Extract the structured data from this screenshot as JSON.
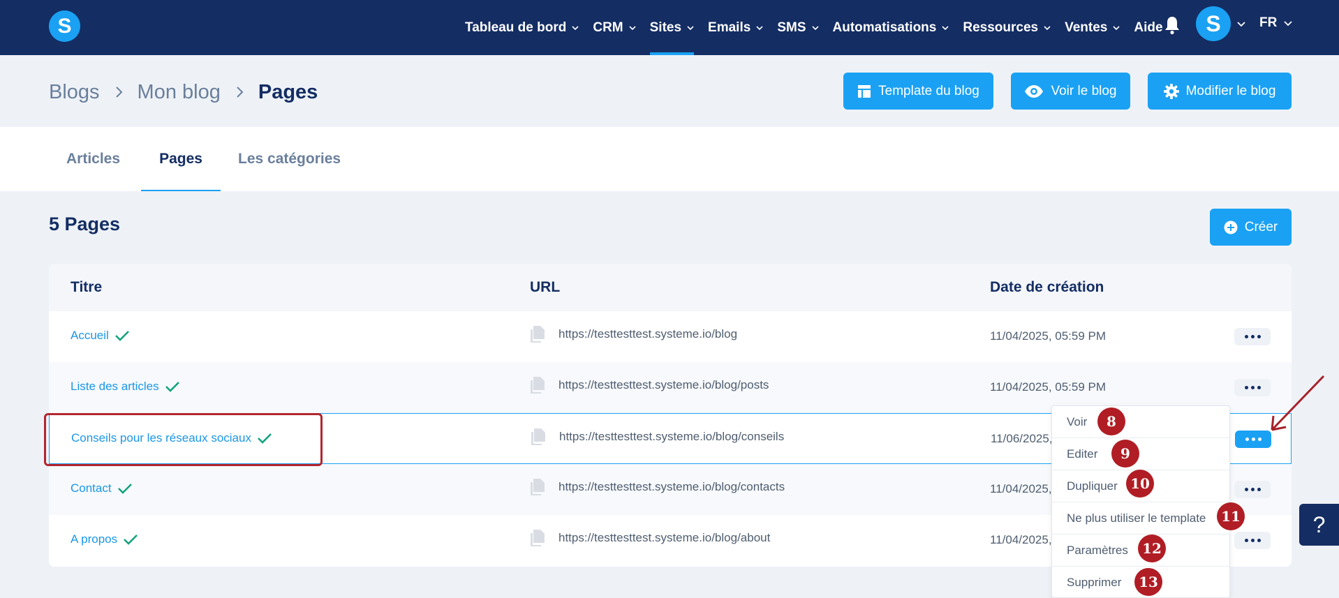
{
  "nav": {
    "logo": "S",
    "items": [
      {
        "label": "Tableau de bord",
        "chevron": true
      },
      {
        "label": "CRM",
        "chevron": true
      },
      {
        "label": "Sites",
        "chevron": true,
        "active": true
      },
      {
        "label": "Emails",
        "chevron": true
      },
      {
        "label": "SMS",
        "chevron": true
      },
      {
        "label": "Automatisations",
        "chevron": true
      },
      {
        "label": "Ressources",
        "chevron": true
      },
      {
        "label": "Ventes",
        "chevron": true
      },
      {
        "label": "Aide",
        "chevron": false
      }
    ],
    "avatar": "S",
    "language": "FR"
  },
  "breadcrumb": [
    "Blogs",
    "Mon blog",
    "Pages"
  ],
  "header_buttons": {
    "template": "Template du blog",
    "view": "Voir le blog",
    "edit": "Modifier le blog"
  },
  "tabs": [
    {
      "label": "Articles",
      "active": false
    },
    {
      "label": "Pages",
      "active": true
    },
    {
      "label": "Les catégories",
      "active": false
    }
  ],
  "page_count_title": "5 Pages",
  "create_label": "Créer",
  "table": {
    "headers": {
      "title": "Titre",
      "url": "URL",
      "date": "Date de création"
    },
    "rows": [
      {
        "title": "Accueil",
        "url": "https://testtesttest.systeme.io/blog",
        "date": "11/04/2025, 05:59 PM"
      },
      {
        "title": "Liste des articles",
        "url": "https://testtesttest.systeme.io/blog/posts",
        "date": "11/04/2025, 05:59 PM"
      },
      {
        "title": "Conseils pour les réseaux sociaux",
        "url": "https://testtesttest.systeme.io/blog/conseils",
        "date": "11/06/2025,"
      },
      {
        "title": "Contact",
        "url": "https://testtesttest.systeme.io/blog/contacts",
        "date": "11/04/2025,"
      },
      {
        "title": "A propos",
        "url": "https://testtesttest.systeme.io/blog/about",
        "date": "11/04/2025,"
      }
    ]
  },
  "dropdown": [
    {
      "label": "Voir",
      "badge": "8"
    },
    {
      "label": "Editer",
      "badge": "9"
    },
    {
      "label": "Dupliquer",
      "badge": "10"
    },
    {
      "label": "Ne plus utiliser le template",
      "badge": "11"
    },
    {
      "label": "Paramètres",
      "badge": "12"
    },
    {
      "label": "Supprimer",
      "badge": "13"
    }
  ],
  "help_label": "?",
  "colors": {
    "nav_bg": "#142d63",
    "accent": "#1aa1f3",
    "link": "#1a97e6",
    "check": "#14a37f",
    "annotation": "#b3262e"
  }
}
